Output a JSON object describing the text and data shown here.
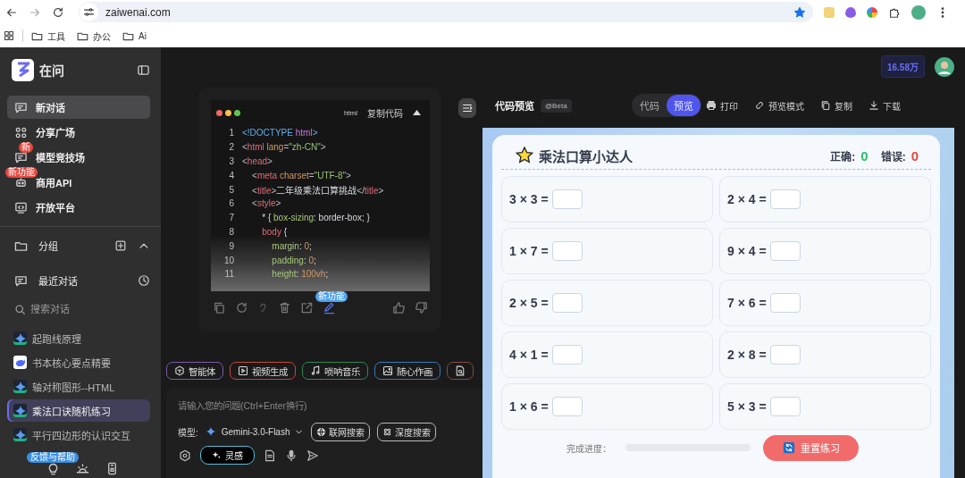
{
  "browser": {
    "url": "zaiwenai.com",
    "bookmarks": [
      {
        "label": "工具"
      },
      {
        "label": "办公"
      },
      {
        "label": "Ai"
      }
    ]
  },
  "sidebar": {
    "brand": "在问",
    "nav": [
      {
        "label": "新对话",
        "selected": true,
        "kind": "chat"
      },
      {
        "label": "分享广场",
        "selected": false,
        "kind": "grid"
      },
      {
        "label": "模型竞技场",
        "selected": false,
        "kind": "chat",
        "badge": "新"
      },
      {
        "label": "商用API",
        "selected": false,
        "kind": "robot",
        "badge": "新功能"
      },
      {
        "label": "开放平台",
        "selected": false,
        "kind": "monitor"
      }
    ],
    "group": "分组",
    "recent_title": "最近对话",
    "search": {
      "placeholder": "搜索对话"
    },
    "recents": [
      {
        "title": "起跑线原理",
        "selected": false,
        "kind": "star"
      },
      {
        "title": "书本核心要点精要",
        "selected": false,
        "kind": "whale"
      },
      {
        "title": "轴对称图形--HTML",
        "selected": false,
        "kind": "star"
      },
      {
        "title": "乘法口诀随机练习",
        "selected": true,
        "kind": "star"
      },
      {
        "title": "平行四边形的认识交互",
        "selected": false,
        "kind": "star"
      }
    ],
    "help_badge": "反馈与帮助"
  },
  "chat": {
    "code_block": {
      "language": "html",
      "copy_label": "复制代码",
      "lines": [
        {
          "number": "1",
          "tokens": [
            {
              "kind": "doctype",
              "text": "<!DOCTYPE "
            },
            {
              "kind": "keyword",
              "text": "html"
            },
            {
              "kind": "doctype",
              "text": ">"
            }
          ]
        },
        {
          "number": "2",
          "tokens": [
            {
              "kind": "punct",
              "text": "<"
            },
            {
              "kind": "tag",
              "text": "html"
            },
            {
              "kind": "attr",
              "text": " lang"
            },
            {
              "kind": "punct",
              "text": "="
            },
            {
              "kind": "str",
              "text": "\"zh-CN\""
            },
            {
              "kind": "punct",
              "text": ">"
            }
          ]
        },
        {
          "number": "3",
          "tokens": [
            {
              "kind": "punct",
              "text": "<"
            },
            {
              "kind": "tag",
              "text": "head"
            },
            {
              "kind": "punct",
              "text": ">"
            }
          ]
        },
        {
          "number": "4",
          "tokens": [
            {
              "kind": "punct",
              "text": "    <"
            },
            {
              "kind": "tag",
              "text": "meta"
            },
            {
              "kind": "attr",
              "text": " charset"
            },
            {
              "kind": "punct",
              "text": "="
            },
            {
              "kind": "str",
              "text": "\"UTF-8\""
            },
            {
              "kind": "punct",
              "text": ">"
            }
          ]
        },
        {
          "number": "5",
          "tokens": [
            {
              "kind": "punct",
              "text": "    <"
            },
            {
              "kind": "tag",
              "text": "title"
            },
            {
              "kind": "punct",
              "text": ">"
            },
            {
              "kind": "text",
              "text": "二年级乘法口算挑战"
            },
            {
              "kind": "punct",
              "text": "</"
            },
            {
              "kind": "tag",
              "text": "title"
            },
            {
              "kind": "punct",
              "text": ">"
            }
          ]
        },
        {
          "number": "6",
          "tokens": [
            {
              "kind": "punct",
              "text": "    <"
            },
            {
              "kind": "tag",
              "text": "style"
            },
            {
              "kind": "punct",
              "text": ">"
            }
          ]
        },
        {
          "number": "7",
          "tokens": [
            {
              "kind": "text",
              "text": "        * { "
            },
            {
              "kind": "prop",
              "text": "box-sizing"
            },
            {
              "kind": "text",
              "text": ": border-box; }"
            }
          ]
        },
        {
          "number": "8",
          "tokens": [
            {
              "kind": "tag",
              "text": "        body"
            },
            {
              "kind": "text",
              "text": " {"
            }
          ]
        },
        {
          "number": "9",
          "tokens": [
            {
              "kind": "prop",
              "text": "            margin"
            },
            {
              "kind": "text",
              "text": ": "
            },
            {
              "kind": "num",
              "text": "0"
            },
            {
              "kind": "text",
              "text": ";"
            }
          ]
        },
        {
          "number": "10",
          "tokens": [
            {
              "kind": "prop",
              "text": "            padding"
            },
            {
              "kind": "text",
              "text": ": "
            },
            {
              "kind": "num",
              "text": "0"
            },
            {
              "kind": "text",
              "text": ";"
            }
          ]
        },
        {
          "number": "11",
          "tokens": [
            {
              "kind": "prop",
              "text": "            height"
            },
            {
              "kind": "text",
              "text": ": "
            },
            {
              "kind": "num",
              "text": "100vh"
            },
            {
              "kind": "text",
              "text": ";"
            }
          ]
        }
      ]
    },
    "edit_badge": "新功能",
    "tools": [
      {
        "label": "智能体",
        "kind": "agent",
        "color": "#7b5ca8"
      },
      {
        "label": "视频生成",
        "kind": "video",
        "color": "#c4473a"
      },
      {
        "label": "唢呐音乐",
        "kind": "music",
        "color": "#2f8a4e"
      },
      {
        "label": "随心作画",
        "kind": "image",
        "color": "#3a78b5"
      },
      {
        "kind": "doc",
        "color": "#8a4a3a"
      }
    ],
    "input": {
      "placeholder": "请输入您的问题(Ctrl+Enter换行)",
      "model_label": "模型:",
      "model": "Gemini-3.0-Flash",
      "options": [
        {
          "label": "联网搜索",
          "kind": "globe"
        },
        {
          "label": "深度搜索",
          "kind": "atom"
        }
      ],
      "inspire": "灵感"
    }
  },
  "preview": {
    "credits": "16.58万",
    "title": "代码预览",
    "beta": "@Beta",
    "modes": [
      {
        "label": "代码",
        "selected": false
      },
      {
        "label": "预览",
        "selected": true
      }
    ],
    "actions": [
      {
        "label": "打印",
        "kind": "print"
      },
      {
        "label": "预览模式",
        "kind": "link"
      },
      {
        "label": "复制",
        "kind": "copy"
      },
      {
        "label": "下载",
        "kind": "download"
      }
    ],
    "app": {
      "title": "乘法口算小达人",
      "correct_label": "正确:",
      "correct": "0",
      "wrong_label": "错误:",
      "wrong": "0",
      "problems": [
        "3 × 3 =",
        "2 × 4 =",
        "1 × 7 =",
        "9 × 4 =",
        "2 × 5 =",
        "7 × 6 =",
        "4 × 1 =",
        "2 × 8 =",
        "1 × 6 =",
        "5 × 3 ="
      ],
      "progress_label": "完成进度：",
      "progress": {
        "level": 0
      },
      "reset": "重置练习"
    }
  }
}
